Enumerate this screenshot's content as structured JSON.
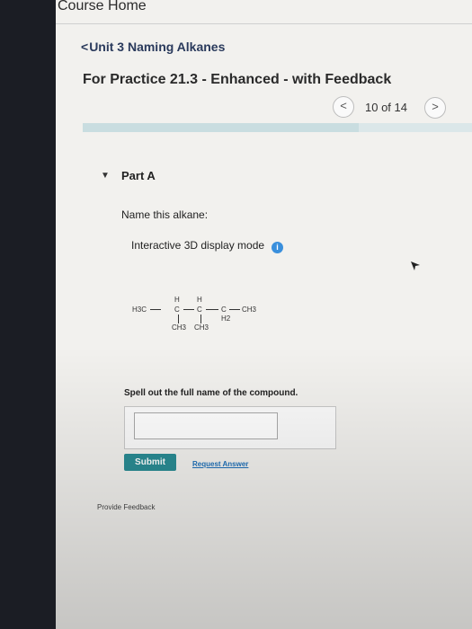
{
  "header": {
    "course_home": "Course Home"
  },
  "breadcrumb": {
    "chevron": "<",
    "label": "Unit 3 Naming Alkanes"
  },
  "assignment": {
    "title": "For Practice 21.3 - Enhanced - with Feedback",
    "prev_label": "<",
    "next_label": ">",
    "page_count": "10 of 14",
    "progress_fraction": 0.71
  },
  "part": {
    "toggle_glyph": "▼",
    "label": "Part A",
    "question": "Name this alkane:",
    "mode_text": "Interactive 3D display mode",
    "info_glyph": "i"
  },
  "molecule": {
    "h3c": "H3C",
    "h_top_1": "H",
    "h_top_2": "H",
    "c1": "C",
    "c2": "C",
    "c3": "C",
    "h2": "H2",
    "ch3_end": "CH3",
    "ch3_branch_1": "CH3",
    "ch3_branch_2": "CH3"
  },
  "answer": {
    "instruction": "Spell out the full name of the compound.",
    "value": "",
    "submit_label": "Submit",
    "request_label": "Request Answer"
  },
  "footer": {
    "feedback_label": "Provide Feedback"
  },
  "colors": {
    "accent": "#2a8c94",
    "link": "#1d6fb8",
    "info": "#3a8fdc"
  }
}
